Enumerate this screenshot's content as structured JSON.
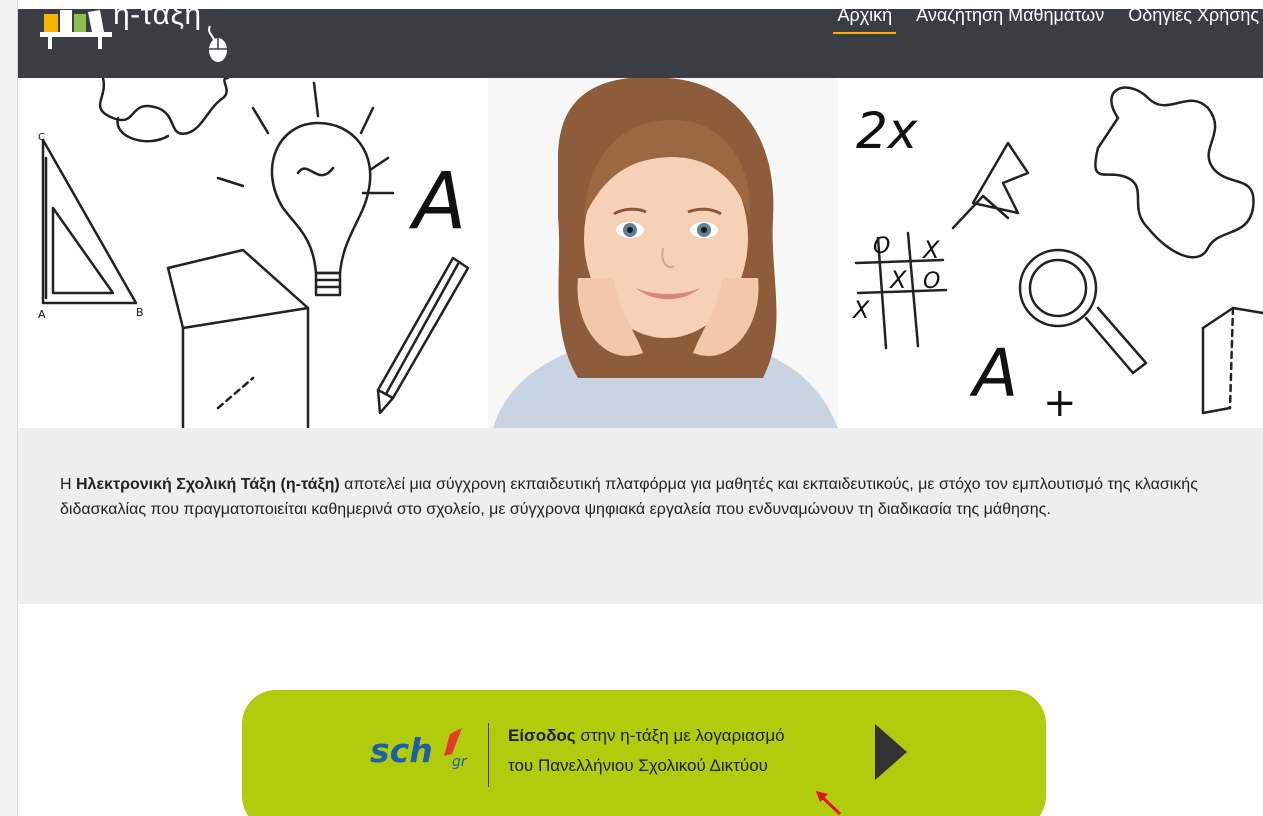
{
  "logo": {
    "text": "η-τάξη"
  },
  "nav": {
    "items": [
      {
        "label": "Αρχική",
        "active": true
      },
      {
        "label": "Αναζήτηση Μαθημάτων",
        "active": false
      },
      {
        "label": "Οδηγίες Χρήσης",
        "active": false
      }
    ]
  },
  "hero": {
    "letters": [
      "A",
      "+",
      "2x",
      "A",
      "+",
      "A",
      "B",
      "C"
    ],
    "ttt": [
      "O",
      "X",
      "X",
      "O",
      "X"
    ]
  },
  "intro": {
    "prefix": "Η ",
    "name": "Ηλεκτρονική Σχολική Τάξη (η-τάξη)",
    "suffix": " αποτελεί μια σύγχρονη εκπαιδευτική πλατφόρμα για μαθητές και εκπαιδευτικούς, με στόχο τον εμπλουτισμό της κλασικής διδασκαλίας που πραγματοποιείται καθημερινά στο σχολείο, με σύγχρονα ψηφιακά εργαλεία που ενδυναμώνουν τη διαδικασία της μάθησης."
  },
  "login": {
    "logo_text": "sch",
    "logo_suffix": "gr",
    "bold": "Είσοδος",
    "line1_rest": " στην η-τάξη με λογαριασμό",
    "line2": "του Πανελλήνιου Σχολικού Δικτύου"
  },
  "colors": {
    "navbar": "#3a3d44",
    "accent": "#f5b400",
    "login_bg": "#b1cc0c",
    "intro_bg": "#eeeeee"
  }
}
